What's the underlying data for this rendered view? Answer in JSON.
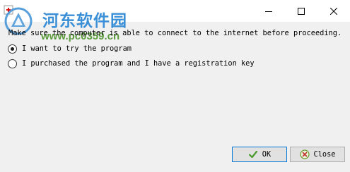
{
  "window": {
    "title": "",
    "watermark": {
      "site_name": "河东软件园",
      "url": "www.pc0359.cn"
    }
  },
  "content": {
    "notice": "Make sure the computer is able to connect to the internet before proceeding.",
    "options": [
      {
        "label": "I want to try the program",
        "selected": true
      },
      {
        "label": "I purchased the program and I have a registration key",
        "selected": false
      }
    ]
  },
  "buttons": {
    "ok_label": "OK",
    "close_label": "Close"
  },
  "colors": {
    "ok_icon": "#4a9a2a",
    "close_icon": "#6a9a2a",
    "watermark_title": "#3a8fd6",
    "watermark_url": "#5a9b3b"
  },
  "icons": {
    "app": "app-icon",
    "minimize": "minimize-icon",
    "maximize": "maximize-icon",
    "close": "close-icon",
    "ok": "checkmark-icon",
    "close_button": "cancel-icon"
  }
}
